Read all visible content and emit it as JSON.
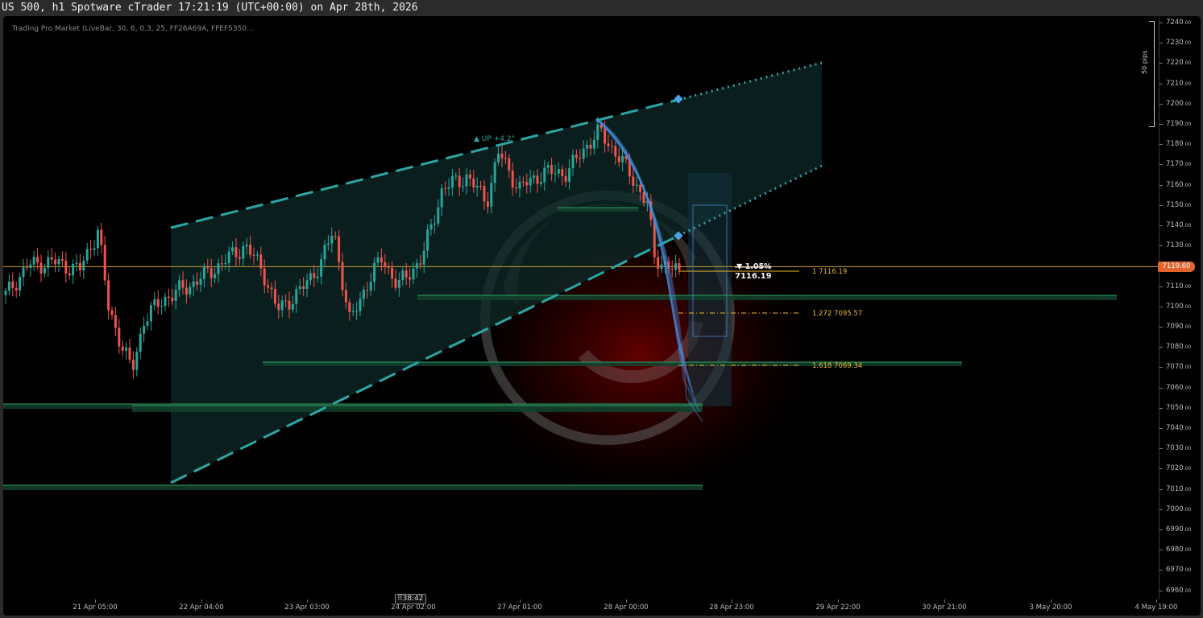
{
  "window": {
    "title": "US 500, h1 Spotware cTrader 17:21:19 (UTC+00:00) on Apr 28th, 2026"
  },
  "indicator": {
    "label": "Trading Pro Market (LiveBar, 30, 6, 0.3, 25, FF26A69A, FFEF5350..."
  },
  "price_axis": {
    "ticks": [
      "7240",
      "7230",
      "7220",
      "7210",
      "7200",
      "7190",
      "7180",
      "7170",
      "7160",
      "7150",
      "7140",
      "7130",
      "7120",
      "7110",
      "7100",
      "7090",
      "7080",
      "7070",
      "7060",
      "7050",
      "7040",
      "7030",
      "7020",
      "7010",
      "7000",
      "6990",
      "6980",
      "6970",
      "6960"
    ],
    "decimals": ".00",
    "current_price": "7119.60"
  },
  "time_axis": {
    "ticks": [
      "21 Apr 05:00",
      "22 Apr 04:00",
      "23 Apr 03:00",
      "24 Apr 02:00",
      "27 Apr 01:00",
      "28 Apr 00:00",
      "28 Apr 23:00",
      "29 Apr 22:00",
      "30 Apr 21:00",
      "3 May 20:00",
      "4 May 19:00"
    ]
  },
  "scale": {
    "label": "50 pips"
  },
  "countdown": "38:42",
  "channel": {
    "label": "▲ UP +4.2°"
  },
  "projection": {
    "change": "▼ 1.05%",
    "price": "7116.19"
  },
  "fib_levels": [
    {
      "ratio": "1",
      "price": "7116.19"
    },
    {
      "ratio": "1.272",
      "price": "7095.57"
    },
    {
      "ratio": "1.618",
      "price": "7069.34"
    }
  ],
  "colors": {
    "background": "#000000",
    "bull": "#26A69A",
    "bear": "#EF5350",
    "channel_line": "#2CA6A4",
    "current_price_line": "#c8a032",
    "current_price_tag": "#e2632b",
    "fib": "#e8b62b",
    "zone": "#2e8b57",
    "projection": "#4a90e2"
  }
}
